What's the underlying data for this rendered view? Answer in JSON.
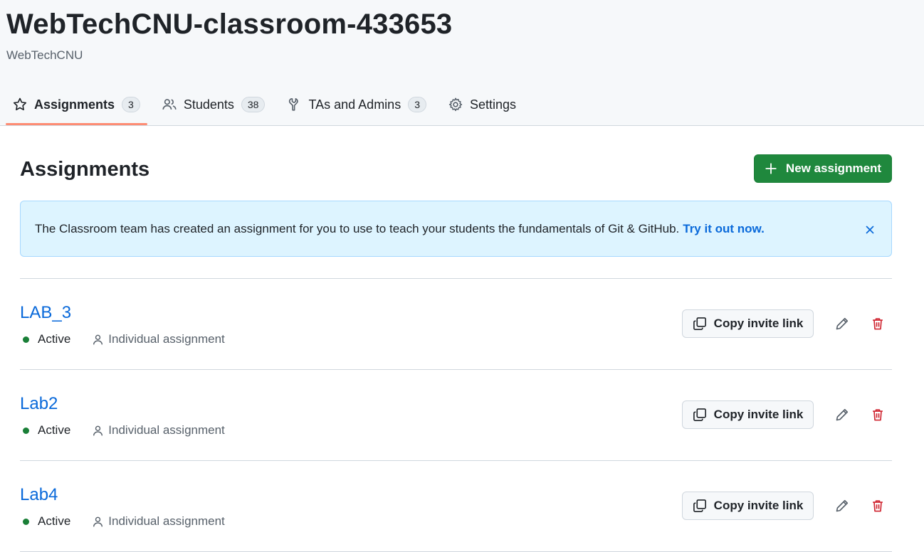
{
  "header": {
    "title": "WebTechCNU-classroom-433653",
    "subtitle": "WebTechCNU"
  },
  "tabs": [
    {
      "label": "Assignments",
      "count": "3",
      "icon": "star-icon",
      "active": true
    },
    {
      "label": "Students",
      "count": "38",
      "icon": "people-icon"
    },
    {
      "label": "TAs and Admins",
      "count": "3",
      "icon": "tools-icon"
    },
    {
      "label": "Settings",
      "icon": "gear-icon"
    }
  ],
  "main": {
    "title": "Assignments",
    "new_button": "New assignment",
    "banner": {
      "text": "The Classroom team has created an assignment for you to use to teach your students the fundamentals of Git & GitHub.",
      "link": "Try it out now."
    },
    "copy_label": "Copy invite link",
    "assignments": [
      {
        "name": "LAB_3",
        "status": "Active",
        "type": "Individual assignment"
      },
      {
        "name": "Lab2",
        "status": "Active",
        "type": "Individual assignment"
      },
      {
        "name": "Lab4",
        "status": "Active",
        "type": "Individual assignment"
      }
    ]
  },
  "colors": {
    "primary_green": "#1f883d",
    "link_blue": "#0969da",
    "tab_underline": "#fd8c73",
    "danger_red": "#cf222e",
    "banner_bg": "#ddf4ff"
  }
}
